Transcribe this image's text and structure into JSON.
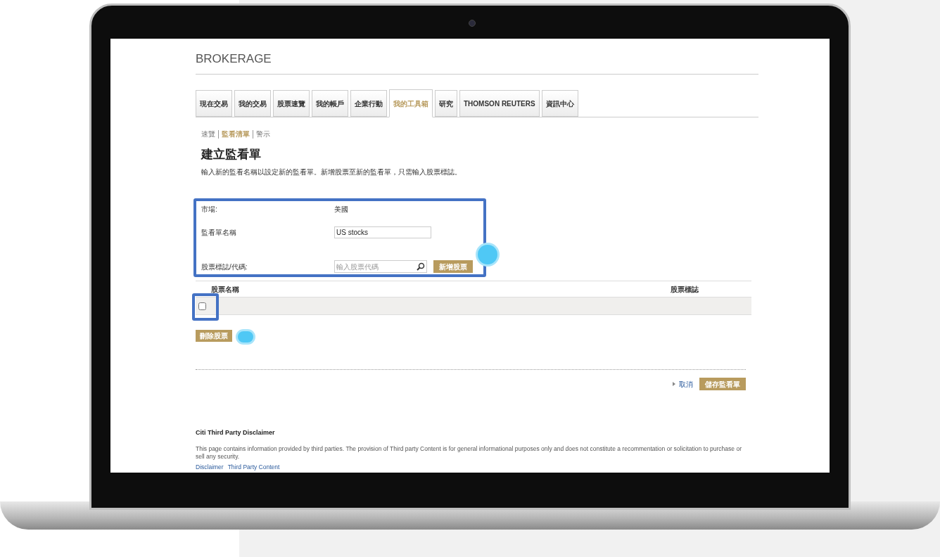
{
  "brand": "BROKERAGE",
  "tabs": [
    {
      "label": "現在交易",
      "selected": false
    },
    {
      "label": "我的交易",
      "selected": false
    },
    {
      "label": "股票速覽",
      "selected": false
    },
    {
      "label": "我的帳戶",
      "selected": false
    },
    {
      "label": "企業行動",
      "selected": false
    },
    {
      "label": "我的工具箱",
      "selected": true
    },
    {
      "label": "研究",
      "selected": false
    },
    {
      "label": "THOMSON REUTERS",
      "selected": false
    },
    {
      "label": "資訊中心",
      "selected": false
    }
  ],
  "subnav": [
    {
      "label": "速覽",
      "selected": false
    },
    {
      "label": "監看清單",
      "selected": true
    },
    {
      "label": "警示",
      "selected": false
    }
  ],
  "title": "建立監看單",
  "description": "輸入新的監看名稱以設定新的監看單。新增股票至新的監看單，只需輸入股票標誌。",
  "form": {
    "market_label": "市場:",
    "market_value": "美國",
    "name_label": "監看單名稱",
    "name_value": "US stocks",
    "symbol_label": "股票標誌/代碼:",
    "symbol_placeholder": "輸入股票代碼",
    "add_button": "新增股票"
  },
  "table": {
    "columns": [
      "股票名稱",
      "股票標誌"
    ],
    "rows": [
      {
        "checked": false
      }
    ]
  },
  "delete_button": "刪除股票",
  "cancel_link": "取消",
  "save_button": "儲存監看單",
  "disclaimer": {
    "title": "Citi Third Party Disclaimer",
    "text": "This page contains information provided by third parties. The provision of Third party Content is for general informational purposes only and does not constitute a recommentation or solicitation to purchase or sell any security.",
    "links": [
      "Disclaimer",
      "Third Party Content"
    ]
  }
}
